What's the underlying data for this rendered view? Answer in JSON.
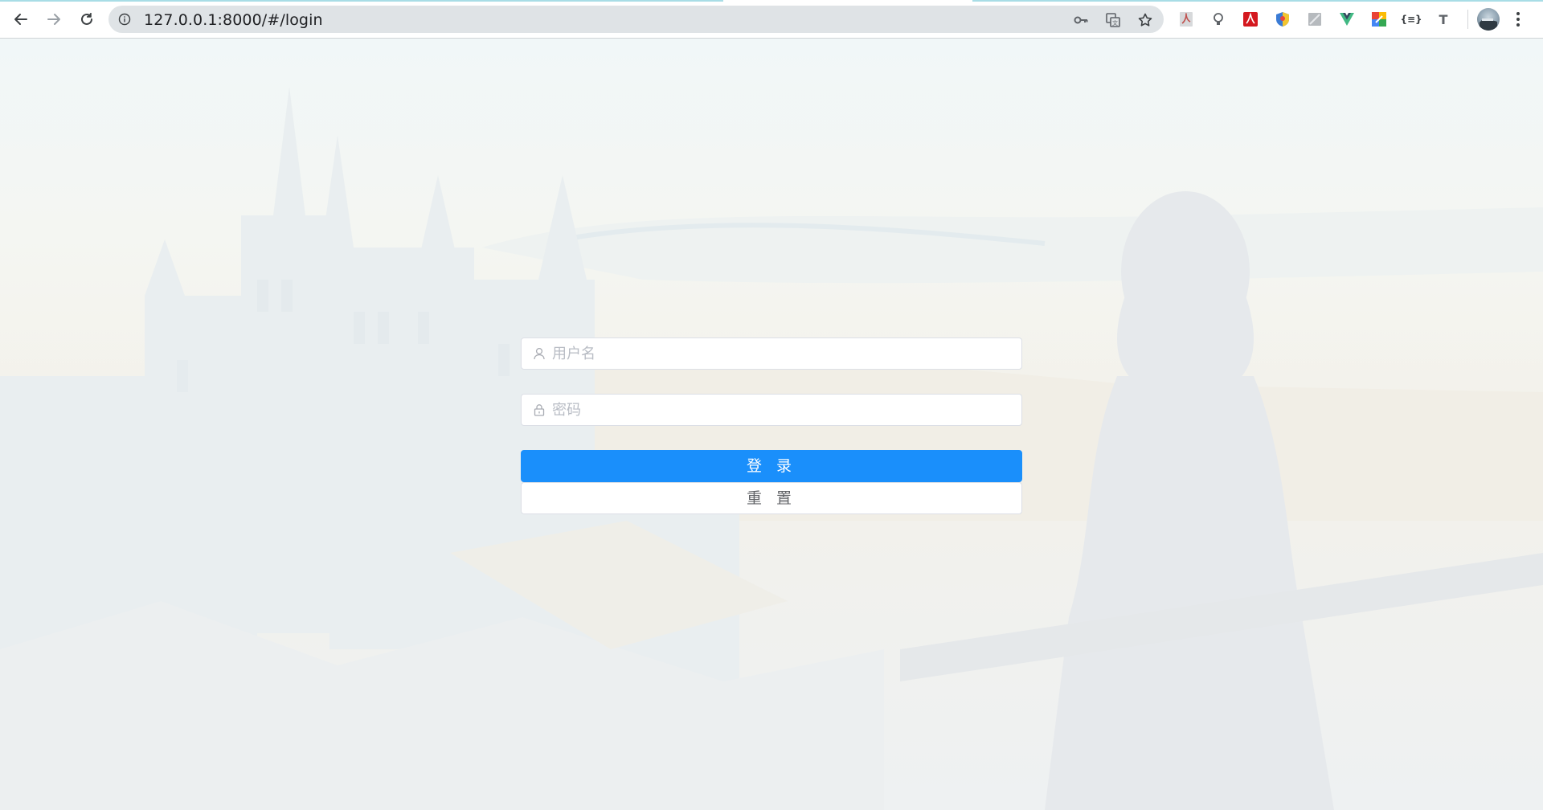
{
  "browser": {
    "url": "127.0.0.1:8000/#/login",
    "toolbar_icons": [
      "back-icon",
      "forward-icon",
      "reload-icon",
      "site-info-icon",
      "key-icon",
      "translate-icon",
      "bookmark-star-icon"
    ],
    "extensions": [
      {
        "name": "pdf-extension-icon",
        "color": "#c0504d"
      },
      {
        "name": "lightbulb-extension-icon",
        "color": "#5f6368"
      },
      {
        "name": "adobe-acrobat-extension-icon",
        "color": "#d4181f"
      },
      {
        "name": "shield-extension-icon",
        "color": "#3a7bd5"
      },
      {
        "name": "gray-square-extension-icon",
        "color": "#9aa0a6"
      },
      {
        "name": "vue-devtools-extension-icon",
        "color": "#41b883"
      },
      {
        "name": "colorful-extension-icon",
        "color": "#f4b400"
      },
      {
        "name": "json-extension-icon",
        "color": "#3c4043",
        "label": "{≡}"
      },
      {
        "name": "t-extension-icon",
        "color": "#5f6368",
        "label": "T"
      }
    ]
  },
  "login": {
    "username_placeholder": "用户名",
    "password_placeholder": "密码",
    "login_label": "登 录",
    "reset_label": "重 置",
    "colors": {
      "primary": "#1a8ffb",
      "border": "#dcdfe6",
      "placeholder": "#b8bcc4"
    }
  }
}
